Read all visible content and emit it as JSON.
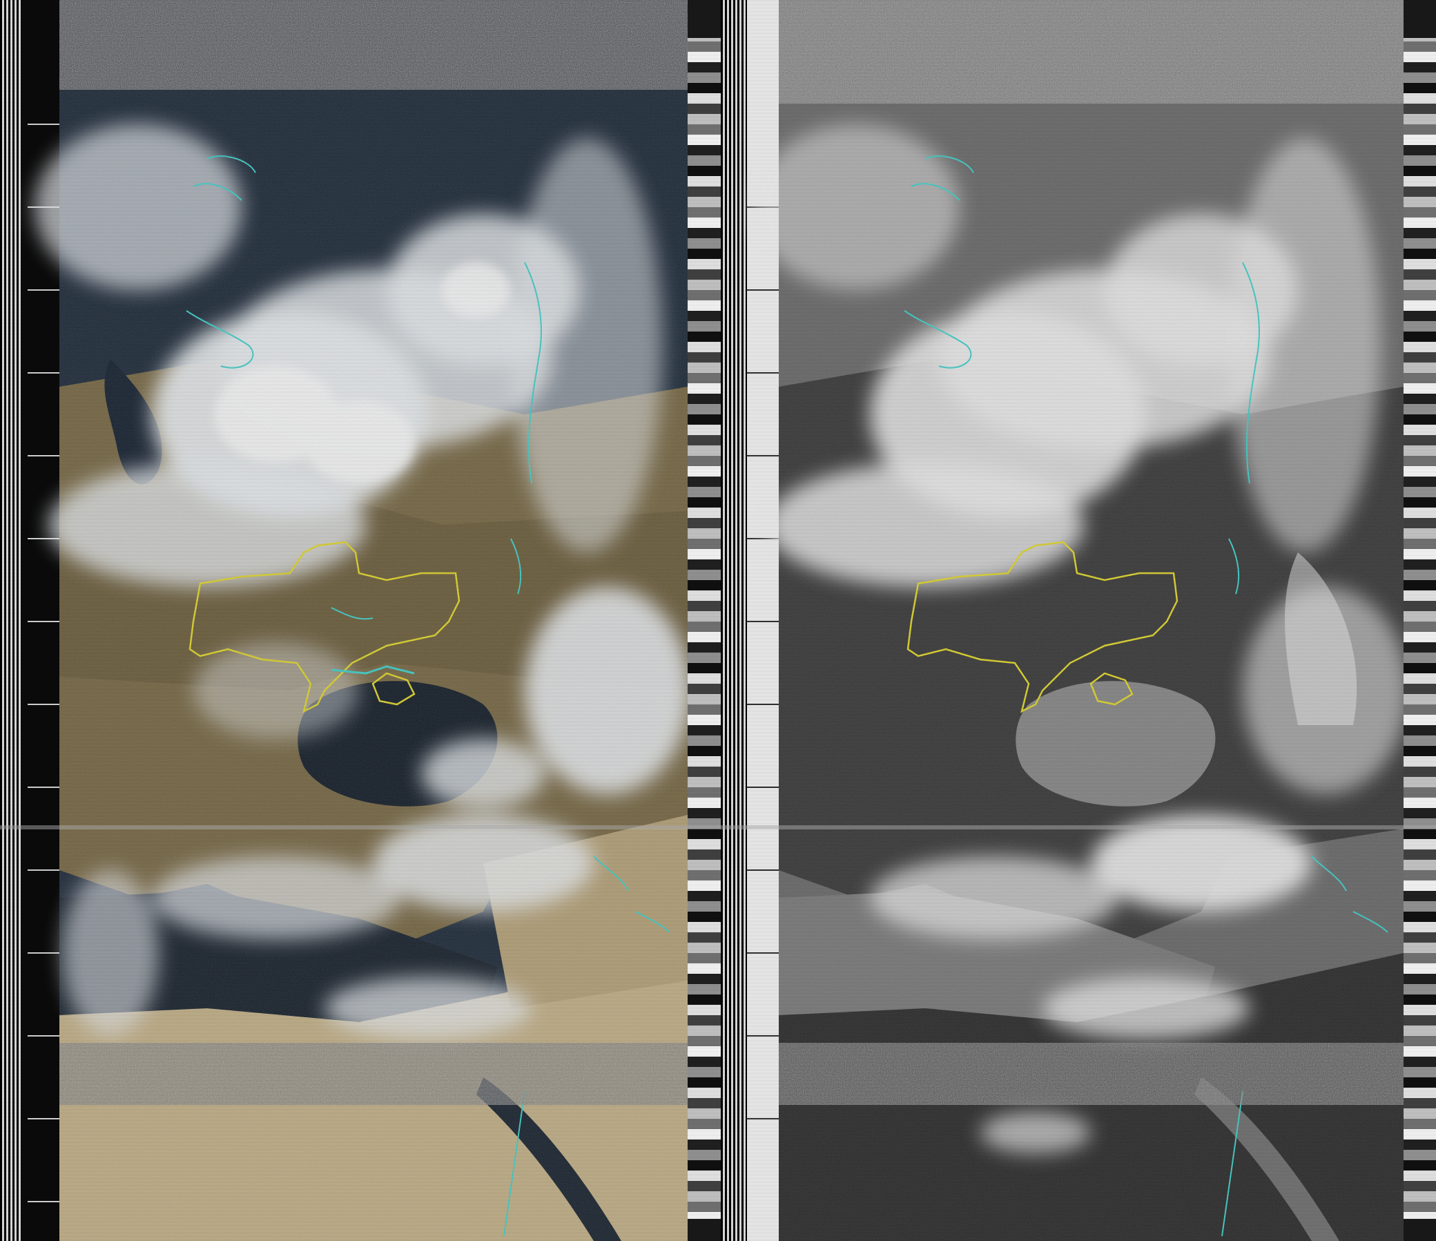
{
  "image": {
    "kind": "APT weather satellite image",
    "channels": [
      {
        "name": "visible-color",
        "palette": "false-color"
      },
      {
        "name": "infrared",
        "palette": "grayscale"
      }
    ],
    "overlays": [
      {
        "name": "coastlines",
        "color": "#3fd6d0"
      },
      {
        "name": "highlighted-border",
        "color": "#e6dc2a"
      }
    ],
    "colors": {
      "sea": "#1d2a3a",
      "land": "#7a6a45",
      "desert": "#c7b48a",
      "cloud": "#eef2f6",
      "noise_dark": "#222222",
      "ir_land": "#3a3a3a",
      "ir_sea": "#8a8a8a",
      "ir_cloud": "#f2f2f2"
    }
  }
}
